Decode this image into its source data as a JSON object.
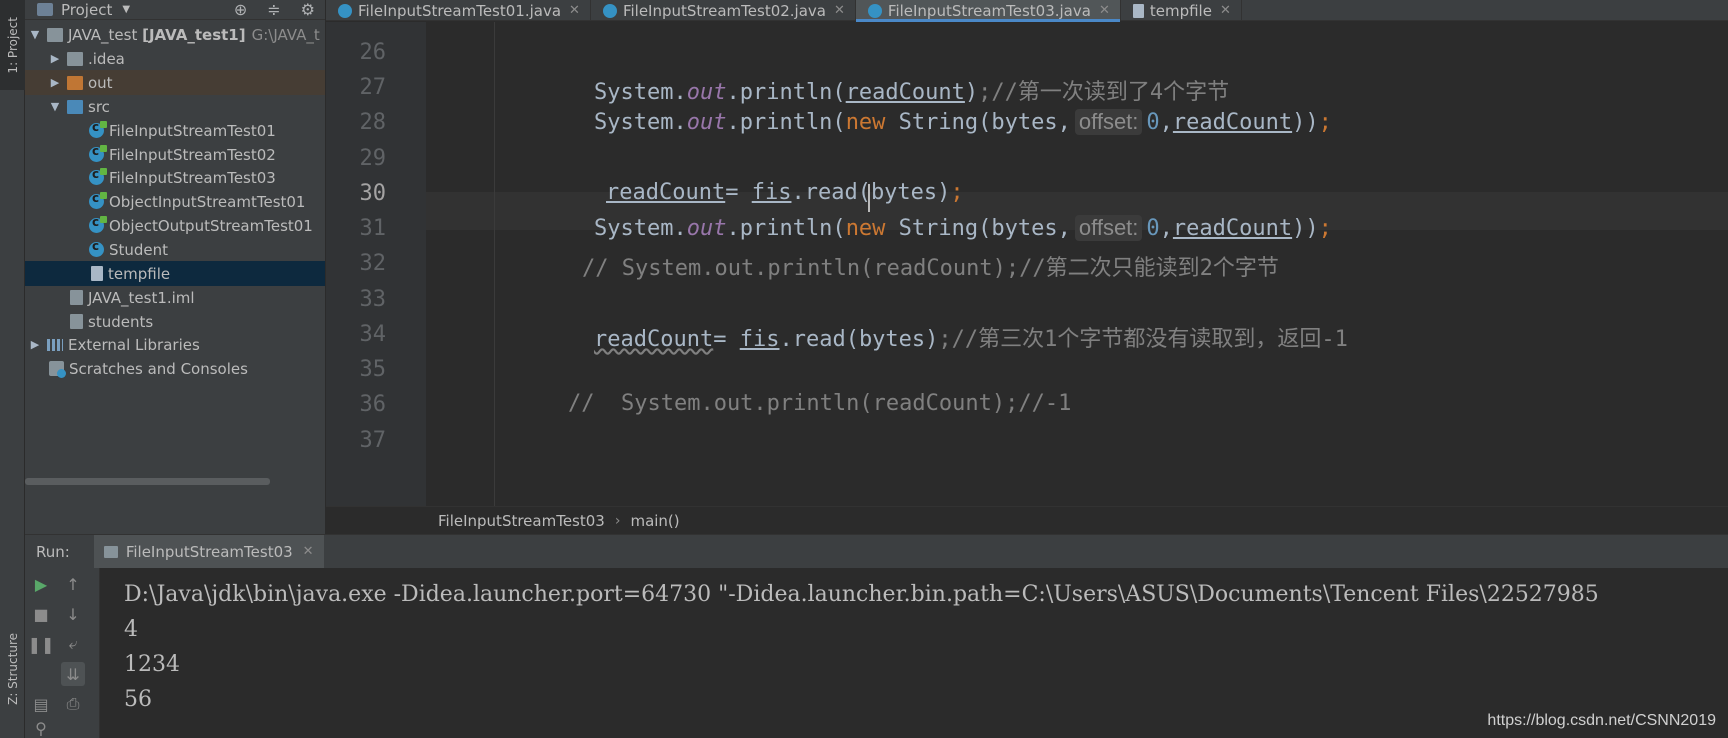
{
  "left_strip": {
    "project_tab": "1: Project",
    "structure_tab": "Z: Structure"
  },
  "project_panel": {
    "title": "Project",
    "tree": [
      {
        "label": "JAVA_test",
        "bold": "[JAVA_test1]",
        "path": "G:\\JAVA_t",
        "icon": "module-folder-icon"
      },
      {
        "label": ".idea",
        "icon": "folder-icon"
      },
      {
        "label": "out",
        "icon": "folder-icon"
      },
      {
        "label": "src",
        "icon": "folder-icon"
      },
      {
        "label": "FileInputStreamTest01",
        "icon": "java-class-icon"
      },
      {
        "label": "FileInputStreamTest02",
        "icon": "java-class-icon"
      },
      {
        "label": "FileInputStreamTest03",
        "icon": "java-class-icon"
      },
      {
        "label": "ObjectInputStreamtTest01",
        "icon": "java-class-icon"
      },
      {
        "label": "ObjectOutputStreamTest01",
        "icon": "java-class-icon"
      },
      {
        "label": "Student",
        "icon": "java-class-icon"
      },
      {
        "label": "tempfile",
        "icon": "text-file-icon"
      },
      {
        "label": "JAVA_test1.iml",
        "icon": "iml-file-icon"
      },
      {
        "label": "students",
        "icon": "file-icon"
      },
      {
        "label": "External Libraries",
        "icon": "library-icon"
      },
      {
        "label": "Scratches and Consoles",
        "icon": "scratches-icon"
      }
    ]
  },
  "tabs": [
    {
      "label": "FileInputStreamTest01.java"
    },
    {
      "label": "FileInputStreamTest02.java"
    },
    {
      "label": "FileInputStreamTest03.java"
    },
    {
      "label": "tempfile"
    }
  ],
  "editor": {
    "current_line": "30",
    "lines": [
      {
        "n": "26"
      },
      {
        "n": "27",
        "var": "readCount",
        "comment": ";//第一次读到了4个字节"
      },
      {
        "n": "28",
        "hint": "offset:",
        "zero": "0",
        "var": "readCount"
      },
      {
        "n": "29"
      },
      {
        "n": "30",
        "var": "readCount",
        "obj": "fis",
        "call": ".read(bytes)"
      },
      {
        "n": "31",
        "hint": "offset:",
        "zero": "0",
        "var": "readCount"
      },
      {
        "n": "32",
        "comment": "// System.out.println(readCount);//第二次只能读到2个字节"
      },
      {
        "n": "33"
      },
      {
        "n": "34",
        "var": "readCount",
        "obj": "fis",
        "call": ".read(bytes)",
        "comment": ";//第三次1个字节都没有读取到，返回-1"
      },
      {
        "n": "35"
      },
      {
        "n": "36",
        "comment": "//  System.out.println(readCount);//-1"
      },
      {
        "n": "37"
      }
    ],
    "tokens": {
      "system": "System.",
      "out": "out",
      "println": ".println(",
      "new": "new",
      "string": " String(bytes,",
      "comma": ",",
      "close": "))",
      "semi": ";",
      "assign": "= "
    }
  },
  "breadcrumb": {
    "file": "FileInputStreamTest03",
    "method": "main()"
  },
  "run_panel": {
    "label": "Run:",
    "tab": "FileInputStreamTest03",
    "console": [
      "D:\\Java\\jdk\\bin\\java.exe -Didea.launcher.port=64730 \"-Didea.launcher.bin.path=C:\\Users\\ASUS\\Documents\\Tencent Files\\22527985",
      "4",
      "1234",
      "56"
    ]
  },
  "watermark": "https://blog.csdn.net/CSNN2019"
}
